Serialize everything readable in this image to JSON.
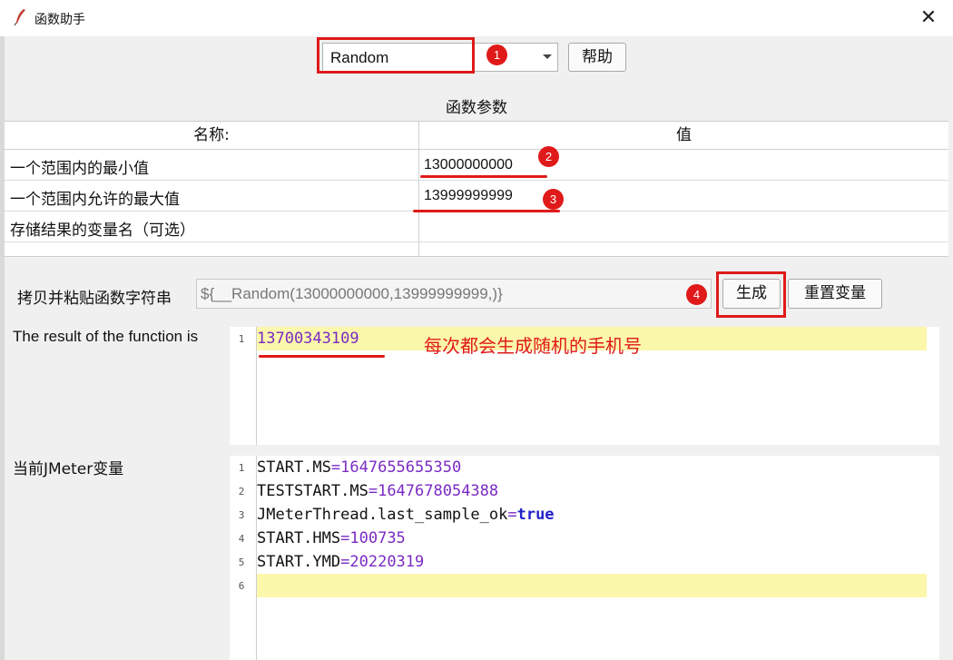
{
  "window": {
    "title": "函数助手",
    "close_glyph": "✕"
  },
  "toolbar": {
    "function_value": "Random",
    "help_label": "帮助"
  },
  "params": {
    "section_title": "函数参数",
    "col_name": "名称:",
    "col_value": "值",
    "rows": [
      {
        "name": "一个范围内的最小值",
        "value": "13000000000"
      },
      {
        "name": "一个范围内允许的最大值",
        "value": "13999999999"
      },
      {
        "name": "存储结果的变量名（可选）",
        "value": ""
      }
    ]
  },
  "copy": {
    "label": "拷贝并粘贴函数字符串",
    "value": "${__Random(13000000000,13999999999,)}",
    "generate_label": "生成",
    "reset_label": "重置变量"
  },
  "result": {
    "label": "The result of the function is",
    "line_number": "1",
    "value": "13700343109"
  },
  "variables": {
    "label": "当前JMeter变量",
    "lines": [
      {
        "num": "1",
        "key": "START.MS",
        "op": "=",
        "val": "1647655655350"
      },
      {
        "num": "2",
        "key": "TESTSTART.MS",
        "op": "=",
        "val": "1647678054388"
      },
      {
        "num": "3",
        "key": "JMeterThread.last_sample_ok",
        "op": "=",
        "val": "true"
      },
      {
        "num": "4",
        "key": "START.HMS",
        "op": "=",
        "val": "100735"
      },
      {
        "num": "5",
        "key": "START.YMD",
        "op": "=",
        "val": "20220319"
      },
      {
        "num": "6",
        "key": "",
        "op": "",
        "val": ""
      }
    ]
  },
  "annotations": {
    "markers": [
      "1",
      "2",
      "3",
      "4"
    ],
    "note": "每次都会生成随机的手机号",
    "color": "#e01a1a"
  },
  "colors": {
    "highlight": "#fbf7ab",
    "number": "#7a2bc4",
    "boolean": "#2222c9"
  }
}
